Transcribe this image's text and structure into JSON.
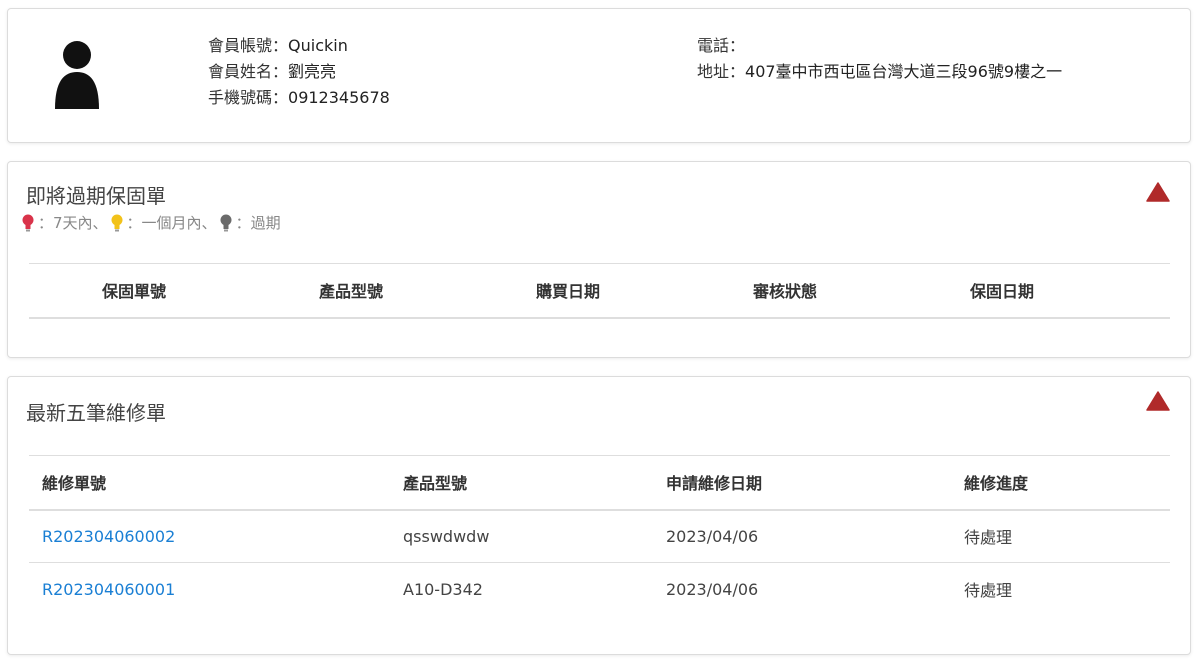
{
  "profile": {
    "account_label": "會員帳號：",
    "account_value": "Quickin",
    "name_label": "會員姓名：",
    "name_value": "劉亮亮",
    "mobile_label": "手機號碼：",
    "mobile_value": "0912345678",
    "phone_label": "電話：",
    "phone_value": "",
    "address_label": "地址：",
    "address_value": "407臺中市西屯區台灣大道三段96號9樓之一"
  },
  "warranty": {
    "title": "即將過期保固單",
    "legend": {
      "red_text": "：7天內、",
      "yellow_text": "：一個月內、",
      "gray_text": "：過期"
    },
    "columns": [
      "保固單號",
      "產品型號",
      "購買日期",
      "審核狀態",
      "保固日期"
    ],
    "rows": []
  },
  "repair": {
    "title": "最新五筆維修單",
    "columns": [
      "維修單號",
      "產品型號",
      "申請維修日期",
      "維修進度"
    ],
    "rows": [
      {
        "id": "R202304060002",
        "model": "qsswdwdw",
        "date": "2023/04/06",
        "status": "待處理"
      },
      {
        "id": "R202304060001",
        "model": "A10-D342",
        "date": "2023/04/06",
        "status": "待處理"
      }
    ]
  },
  "colors": {
    "link": "#1a7fd4",
    "collapse_icon": "#b02a2a",
    "bulb_red": "#d9334a",
    "bulb_yellow": "#f2c21a",
    "bulb_gray": "#6b6b6b"
  },
  "icons": {
    "avatar": "user-silhouette-icon",
    "collapse": "triangle-up-icon",
    "legend": "lightbulb-icon"
  }
}
